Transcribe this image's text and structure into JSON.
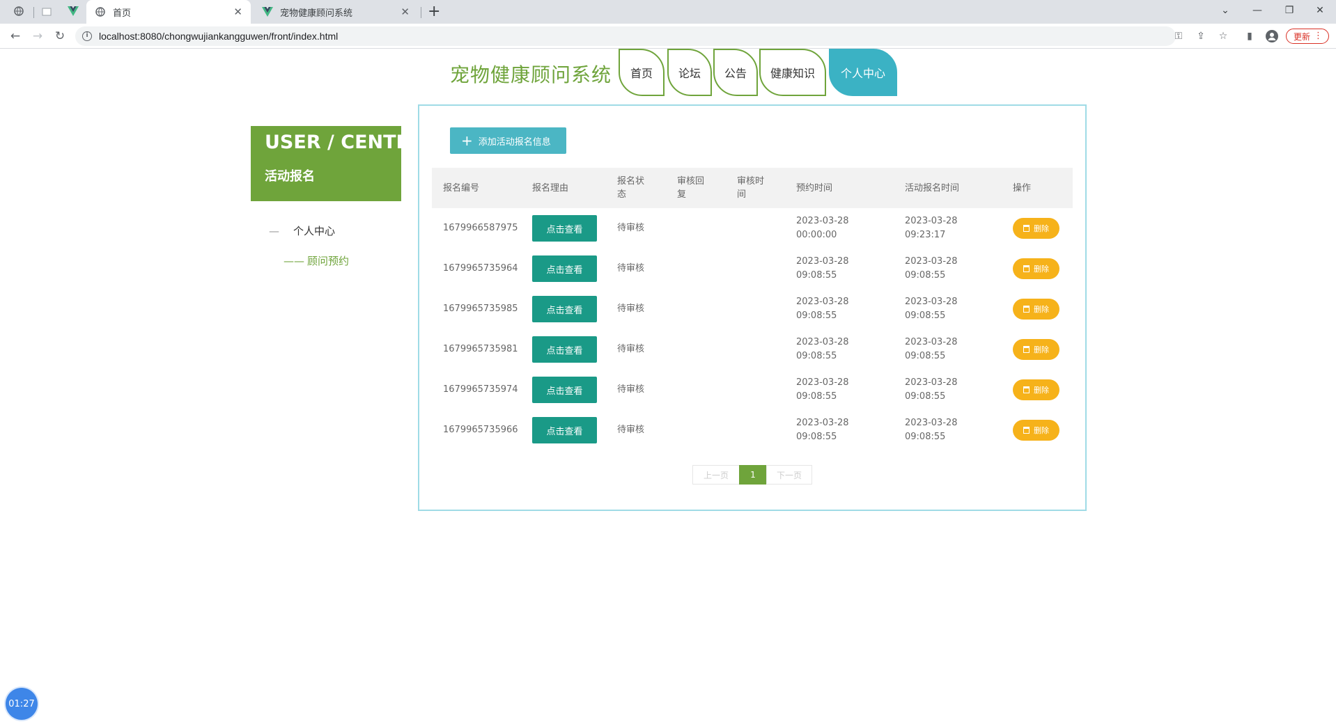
{
  "browser": {
    "tabs": [
      {
        "label": "首页",
        "active": true
      },
      {
        "label": "宠物健康顾问系统",
        "active": false
      }
    ],
    "url": "localhost:8080/chongwujiankangguwen/front/index.html",
    "update_label": "更新"
  },
  "site": {
    "title": "宠物健康顾问系统"
  },
  "nav": {
    "items": [
      {
        "label": "首页"
      },
      {
        "label": "论坛"
      },
      {
        "label": "公告"
      },
      {
        "label": "健康知识"
      },
      {
        "label": "个人中心",
        "active": true
      }
    ]
  },
  "sidebar": {
    "header_title": "USER / CENTER",
    "header_subtitle": "活动报名",
    "items": [
      {
        "label": "个人中心",
        "prefix": "—"
      },
      {
        "label": "顾问预约",
        "prefix": "——"
      }
    ]
  },
  "toolbar": {
    "add_label": "添加活动报名信息"
  },
  "table": {
    "headers": [
      "报名编号",
      "报名理由",
      "报名状态",
      "审核回复",
      "审核时间",
      "预约时间",
      "活动报名时间",
      "操作"
    ],
    "view_label": "点击查看",
    "delete_label": "删除",
    "rows": [
      {
        "id": "1679966587975",
        "status": "待审核",
        "reply": "",
        "review_time": "",
        "appt_date": "2023-03-28",
        "appt_time": "00:00:00",
        "signup_date": "2023-03-28",
        "signup_time": "09:23:17"
      },
      {
        "id": "1679965735964",
        "status": "待审核",
        "reply": "",
        "review_time": "",
        "appt_date": "2023-03-28",
        "appt_time": "09:08:55",
        "signup_date": "2023-03-28",
        "signup_time": "09:08:55"
      },
      {
        "id": "1679965735985",
        "status": "待审核",
        "reply": "",
        "review_time": "",
        "appt_date": "2023-03-28",
        "appt_time": "09:08:55",
        "signup_date": "2023-03-28",
        "signup_time": "09:08:55"
      },
      {
        "id": "1679965735981",
        "status": "待审核",
        "reply": "",
        "review_time": "",
        "appt_date": "2023-03-28",
        "appt_time": "09:08:55",
        "signup_date": "2023-03-28",
        "signup_time": "09:08:55"
      },
      {
        "id": "1679965735974",
        "status": "待审核",
        "reply": "",
        "review_time": "",
        "appt_date": "2023-03-28",
        "appt_time": "09:08:55",
        "signup_date": "2023-03-28",
        "signup_time": "09:08:55"
      },
      {
        "id": "1679965735966",
        "status": "待审核",
        "reply": "",
        "review_time": "",
        "appt_date": "2023-03-28",
        "appt_time": "09:08:55",
        "signup_date": "2023-03-28",
        "signup_time": "09:08:55"
      }
    ]
  },
  "pagination": {
    "prev_label": "上一页",
    "current": "1",
    "next_label": "下一页"
  },
  "timer": {
    "value": "01:27"
  },
  "colors": {
    "brand_green": "#6fa43b",
    "nav_active": "#3bb2c4",
    "view_button": "#1a9a87",
    "delete_button": "#f6b21a",
    "add_button": "#4bb6c4"
  }
}
